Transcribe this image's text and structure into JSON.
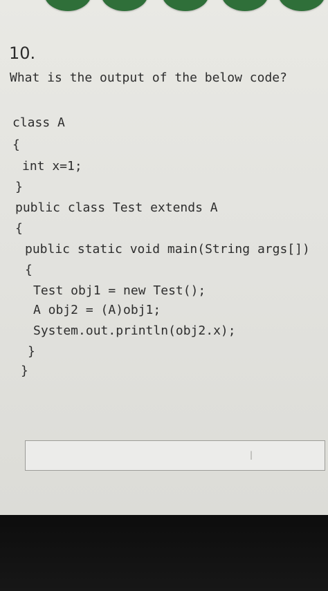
{
  "question": {
    "number": "10.",
    "prompt": "What is the output of the below code?"
  },
  "code": {
    "lines": [
      "class A",
      "{",
      "int x=1;",
      "}",
      "public class Test extends A",
      "{",
      "public static void main(String args[])",
      "{",
      "Test obj1 = new Test();",
      "A obj2 = (A)obj1;",
      "System.out.println(obj2.x);",
      "}",
      "}"
    ]
  },
  "answer": {
    "value": "",
    "cursor_glyph": "|"
  },
  "colors": {
    "screen_bg": "#e6e6e1",
    "text": "#2d2d2d",
    "top_circles": "#2f6f39",
    "bezel": "#111111"
  }
}
